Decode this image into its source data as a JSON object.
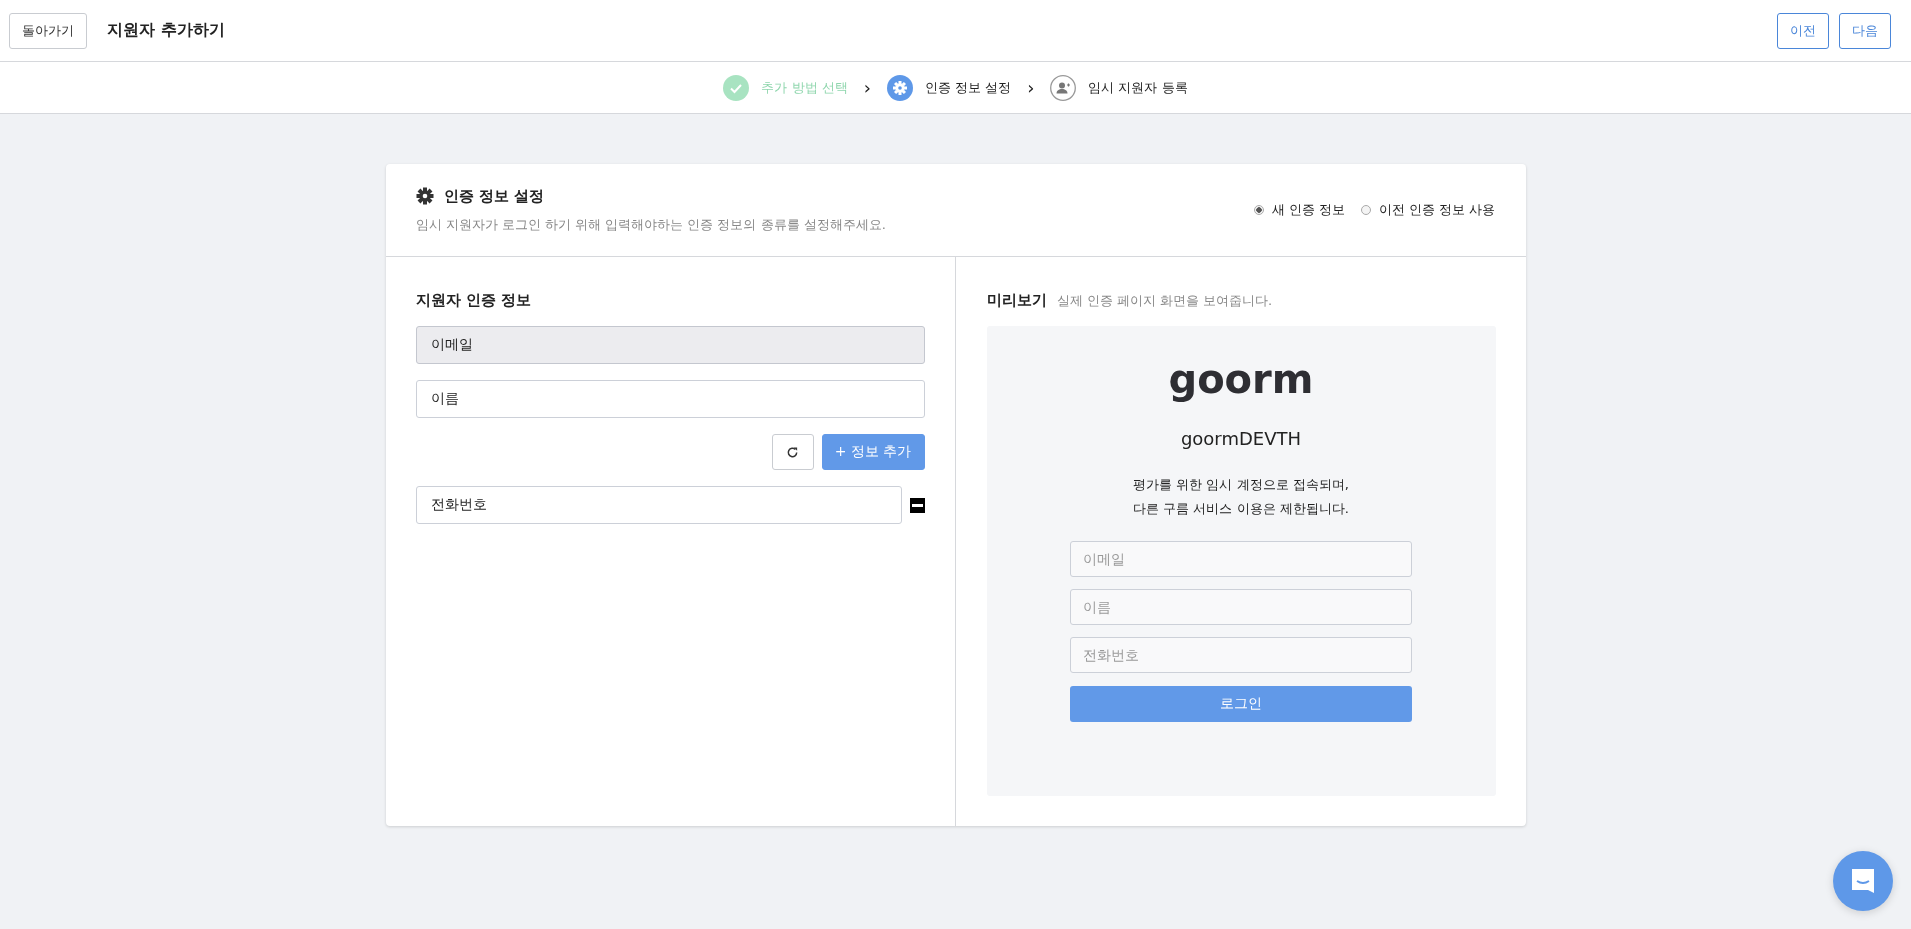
{
  "header": {
    "back_button": "돌아가기",
    "title": "지원자 추가하기",
    "prev_button": "이전",
    "next_button": "다음"
  },
  "stepper": [
    {
      "label": "추가 방법 선택",
      "kind": "done",
      "separator": "›"
    },
    {
      "label": "인증 정보 설정",
      "kind": "current",
      "separator": "›"
    },
    {
      "label": "임시 지원자 등록",
      "kind": "pending"
    }
  ],
  "card": {
    "title": "인증 정보 설정",
    "description": "임시 지원자가 로그인 하기 위해 입력해야하는 인증 정보의 종류를 설정해주세요.",
    "options": [
      {
        "label": "새 인증 정보",
        "selected": true
      },
      {
        "label": "이전 인증 정보 사용",
        "selected": false
      }
    ]
  },
  "applicant_info": {
    "title": "지원자 인증 정보",
    "fields": [
      {
        "value": "이메일",
        "disabled": true
      },
      {
        "value": "이름",
        "disabled": false
      }
    ],
    "add_button": "+ 정보 추가",
    "extra_fields": [
      {
        "value": "전화번호",
        "disabled": false,
        "removable": true
      }
    ]
  },
  "preview": {
    "title": "미리보기",
    "subtitle": "실제 인증 페이지 화면을 보여줍니다.",
    "logo": "goorm",
    "org_name": "goormDEVTH",
    "notice": [
      "평가를 위한 임시 계정으로 접속되며,",
      "다른 구름 서비스 이용은 제한됩니다."
    ],
    "fields": [
      {
        "placeholder": "이메일"
      },
      {
        "placeholder": "이름"
      },
      {
        "placeholder": "전화번호"
      }
    ],
    "login_button": "로그인"
  }
}
